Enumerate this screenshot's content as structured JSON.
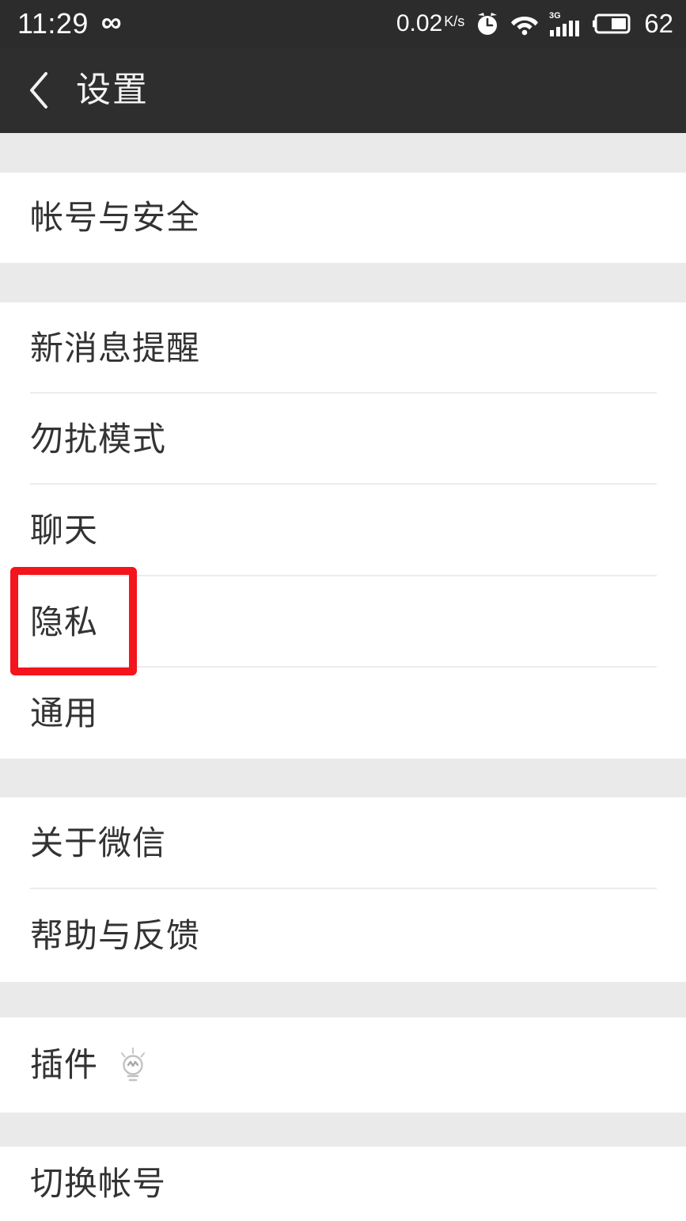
{
  "status_bar": {
    "time": "11:29",
    "infinity_icon": "infinity-icon",
    "network_speed": "0.02",
    "network_unit": "K/s",
    "alarm_icon": "alarm-clock-icon",
    "wifi_icon": "wifi-icon",
    "signal_label": "3G",
    "signal_icon": "signal-bars-icon",
    "battery_icon": "battery-icon",
    "battery_level": "62"
  },
  "header": {
    "back_icon": "back-chevron-icon",
    "title": "设置"
  },
  "groups": [
    {
      "rows": [
        {
          "label": "帐号与安全",
          "name": "account-and-security"
        }
      ]
    },
    {
      "rows": [
        {
          "label": "新消息提醒",
          "name": "new-message-notification"
        },
        {
          "label": "勿扰模式",
          "name": "do-not-disturb"
        },
        {
          "label": "聊天",
          "name": "chat"
        },
        {
          "label": "隐私",
          "name": "privacy"
        },
        {
          "label": "通用",
          "name": "general"
        }
      ]
    },
    {
      "rows": [
        {
          "label": "关于微信",
          "name": "about-wechat"
        },
        {
          "label": "帮助与反馈",
          "name": "help-and-feedback"
        }
      ]
    },
    {
      "rows": [
        {
          "label": "插件",
          "name": "plugins",
          "icon": "lightbulb-icon"
        }
      ]
    },
    {
      "rows": [
        {
          "label": "切换帐号",
          "name": "switch-account"
        }
      ]
    }
  ],
  "annotation": {
    "highlight_target": "隐私",
    "highlight_color": "#f4141c"
  }
}
